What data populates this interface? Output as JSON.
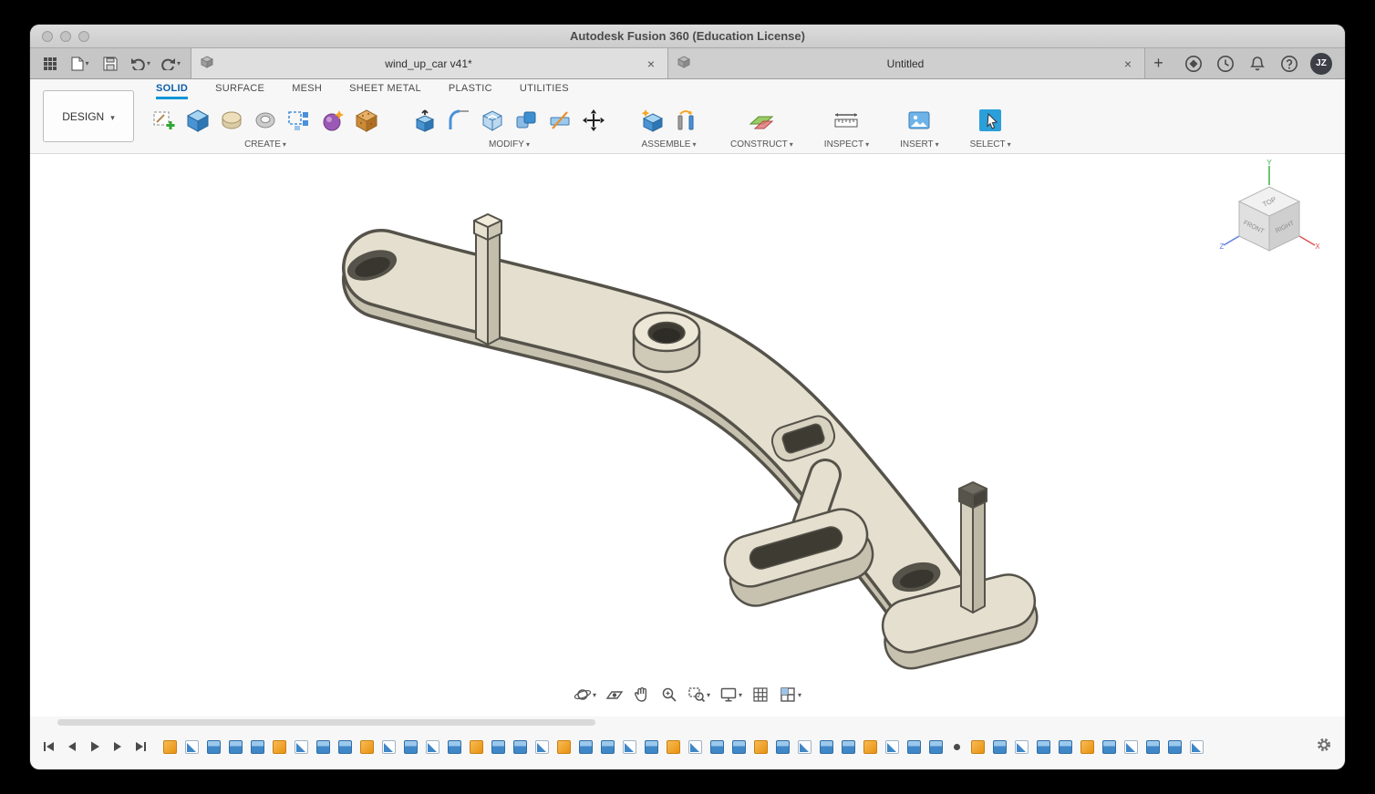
{
  "window": {
    "title": "Autodesk Fusion 360 (Education License)"
  },
  "tabbar": {
    "tabs": [
      {
        "label": "wind_up_car v41*",
        "active": true
      },
      {
        "label": "Untitled",
        "active": false
      }
    ],
    "avatar_initials": "JZ"
  },
  "ribbon": {
    "design_label": "DESIGN",
    "tabs": [
      {
        "label": "SOLID",
        "active": true
      },
      {
        "label": "SURFACE"
      },
      {
        "label": "MESH"
      },
      {
        "label": "SHEET METAL"
      },
      {
        "label": "PLASTIC"
      },
      {
        "label": "UTILITIES"
      }
    ],
    "groups": [
      {
        "label": "CREATE"
      },
      {
        "label": "MODIFY"
      },
      {
        "label": "ASSEMBLE"
      },
      {
        "label": "CONSTRUCT"
      },
      {
        "label": "INSPECT"
      },
      {
        "label": "INSERT"
      },
      {
        "label": "SELECT"
      }
    ]
  },
  "viewcube": {
    "top": "TOP",
    "front": "FRONT",
    "right": "RIGHT",
    "axis_x": "X",
    "axis_y": "Y",
    "axis_z": "Z"
  },
  "colors": {
    "accent_blue": "#0696d7",
    "model_top": "#e4dfce",
    "model_side": "#c7c2b0",
    "model_outline": "#55524a",
    "timeline_blue": "#3f87c7",
    "timeline_orange": "#e8920f"
  },
  "icons": {
    "appbar": [
      "app-grid",
      "file",
      "save",
      "undo",
      "redo"
    ],
    "tab_right": [
      "extensions",
      "job-status-clock",
      "notifications-bell",
      "help",
      "avatar"
    ],
    "navbar": [
      "orbit",
      "look-at",
      "pan",
      "zoom",
      "zoom-window",
      "display-settings",
      "grid",
      "viewports"
    ],
    "timeline_playback": [
      "go-to-start",
      "step-back",
      "play",
      "step-forward",
      "go-to-end"
    ]
  },
  "timeline": {
    "features": [
      "sketch",
      "flag",
      "extrude",
      "extrude",
      "extrude",
      "sketch",
      "flag",
      "extrude",
      "extrude",
      "sketch",
      "flag",
      "extrude",
      "flag",
      "extrude",
      "sketch",
      "extrude",
      "extrude",
      "flag",
      "sketch",
      "extrude",
      "extrude",
      "flag",
      "extrude",
      "sketch",
      "flag",
      "extrude",
      "extrude",
      "sketch",
      "extrude",
      "flag",
      "extrude",
      "extrude",
      "sketch",
      "flag",
      "extrude",
      "extrude",
      "point",
      "sketch",
      "extrude",
      "flag",
      "extrude",
      "extrude",
      "sketch",
      "extrude",
      "flag",
      "extrude",
      "extrude",
      "flag"
    ]
  }
}
